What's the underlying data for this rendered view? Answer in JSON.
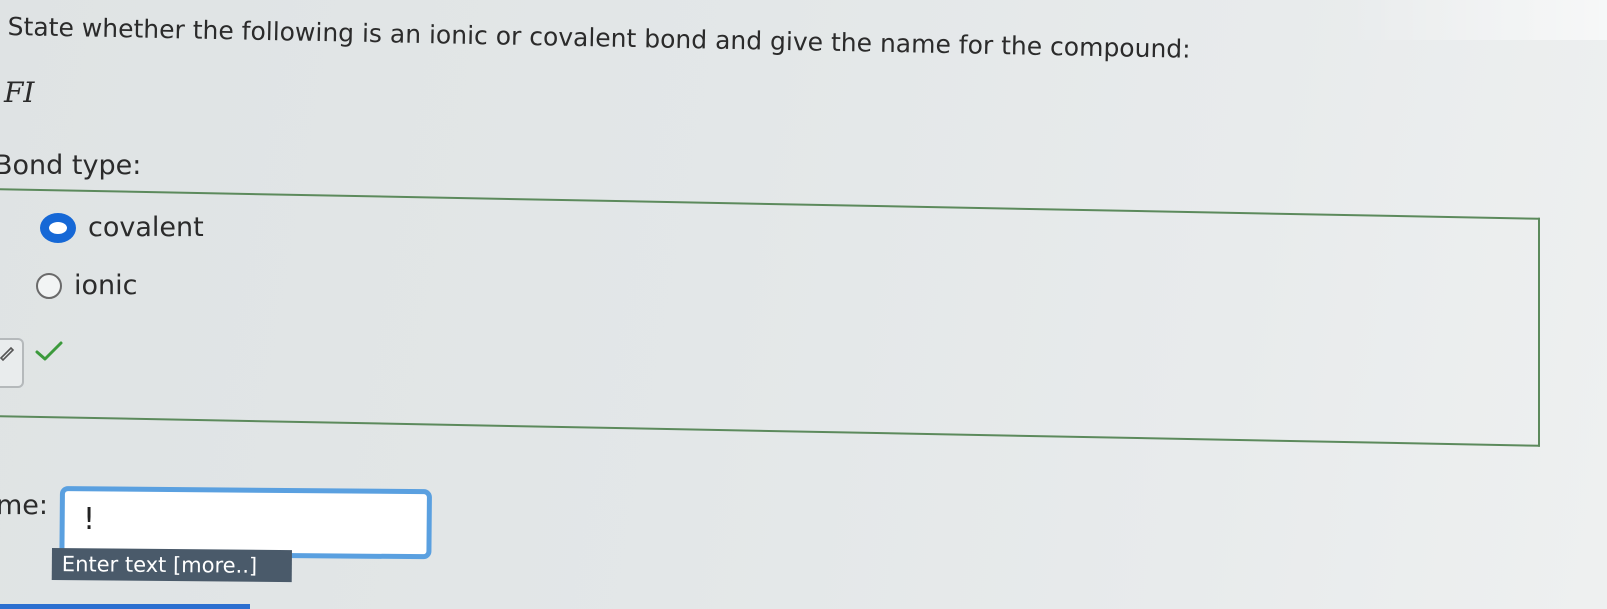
{
  "question": {
    "prompt": "State whether the following is an ionic or covalent bond and give the name for the compound:",
    "formula": "FI"
  },
  "bond": {
    "label": "Bond type:",
    "options": [
      {
        "label": "covalent",
        "selected": true
      },
      {
        "label": "ionic",
        "selected": false
      }
    ],
    "status_icon": "check-icon",
    "edit_icon": "edit-pencil-icon",
    "status_color": "#3c9a3c"
  },
  "name": {
    "label": "me:",
    "value": "",
    "caret": "!",
    "hint": "Enter text [more..]"
  },
  "colors": {
    "accent": "#1668d6",
    "input_border": "#5aa0e0",
    "box_border": "#5c8a5c"
  }
}
